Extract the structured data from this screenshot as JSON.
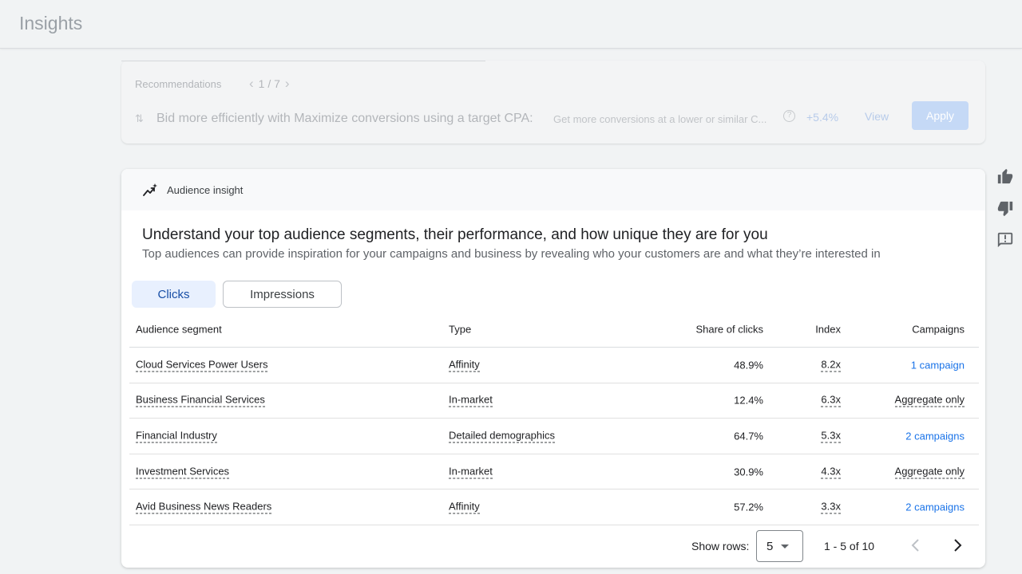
{
  "header": {
    "title": "Insights"
  },
  "recommendations": {
    "label": "Recommendations",
    "pager": "1 / 7",
    "icon": "sort-arrows-icon",
    "title": "Bid more efficiently with Maximize conversions using a target CPA:",
    "description": "Get more conversions at a lower or similar C...",
    "help_icon": "help-circle-icon",
    "uplift": "+5.4%",
    "view_label": "View",
    "apply_label": "Apply"
  },
  "insight": {
    "section_label": "Audience insight",
    "icon": "trending-sparkle-icon",
    "headline": "Understand your top audience segments, their performance, and how unique they are for you",
    "subline": "Top audiences can provide inspiration for your campaigns and business by revealing who your customers are and what they’re interested in",
    "tabs": [
      {
        "label": "Clicks",
        "selected": true
      },
      {
        "label": "Impressions",
        "selected": false
      }
    ],
    "columns": {
      "segment": "Audience segment",
      "type": "Type",
      "share": "Share of clicks",
      "index": "Index",
      "campaigns": "Campaigns"
    },
    "rows": [
      {
        "segment": "Cloud Services Power Users",
        "type": "Affinity",
        "share": "48.9%",
        "index": "8.2x",
        "campaigns": "1 campaign",
        "campaigns_link": true
      },
      {
        "segment": "Business Financial Services",
        "type": "In-market",
        "share": "12.4%",
        "index": "6.3x",
        "campaigns": "Aggregate only",
        "campaigns_link": false
      },
      {
        "segment": "Financial Industry",
        "type": "Detailed demographics",
        "share": "64.7%",
        "index": "5.3x",
        "campaigns": "2 campaigns",
        "campaigns_link": true
      },
      {
        "segment": "Investment Services",
        "type": "In-market",
        "share": "30.9%",
        "index": "4.3x",
        "campaigns": "Aggregate only",
        "campaigns_link": false
      },
      {
        "segment": "Avid Business News Readers",
        "type": "Affinity",
        "share": "57.2%",
        "index": "3.3x",
        "campaigns": "2 campaigns",
        "campaigns_link": true
      }
    ],
    "pagination": {
      "rows_label": "Show rows:",
      "rows_value": "5",
      "range": "1 - 5 of 10"
    }
  },
  "side_actions": [
    "thumbs-up-icon",
    "thumbs-down-icon",
    "feedback-icon"
  ],
  "colors": {
    "accent": "#1a73e8",
    "tab_selected_bg": "#e8f0fe",
    "apply_disabled": "#c5d9f6"
  }
}
